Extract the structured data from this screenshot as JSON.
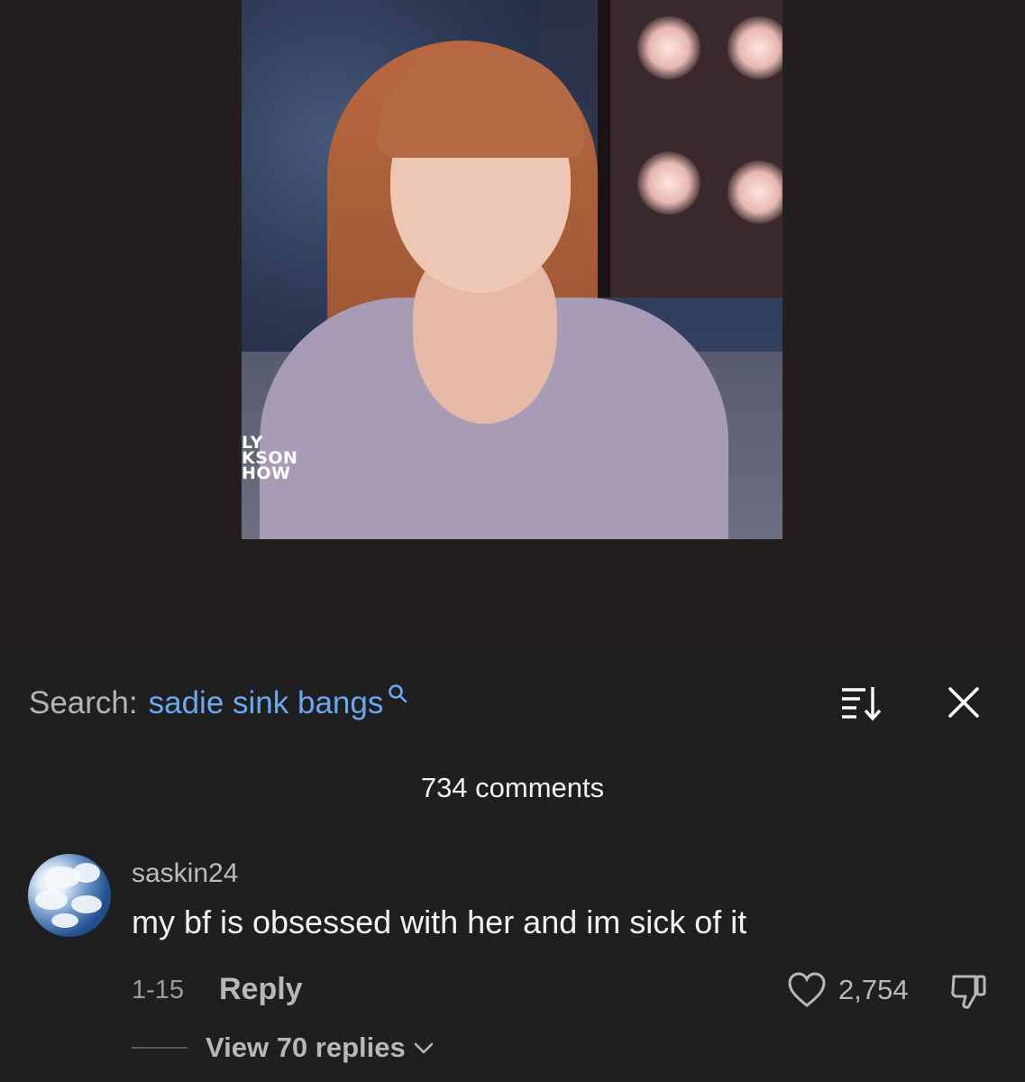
{
  "video": {
    "watermark_lines": [
      "LY",
      "KSON",
      "HOW"
    ]
  },
  "comments_sheet": {
    "search_label": "Search:",
    "search_query": "sadie sink bangs",
    "comment_count": "734 comments",
    "comment": {
      "username": "saskin24",
      "text": "my bf is obsessed with her and im sick of it",
      "date": "1-15",
      "reply_label": "Reply",
      "like_count": "2,754",
      "view_replies_label": "View 70 replies"
    }
  },
  "icons": {
    "search": "search-icon",
    "sort": "sort-icon",
    "close": "close-icon",
    "like": "heart-icon",
    "dislike": "thumbs-down-icon",
    "expand": "chevron-down-icon"
  },
  "colors": {
    "background": "#251e1e",
    "sheet": "#1f1f1f",
    "query_accent": "#6aa8ef"
  }
}
